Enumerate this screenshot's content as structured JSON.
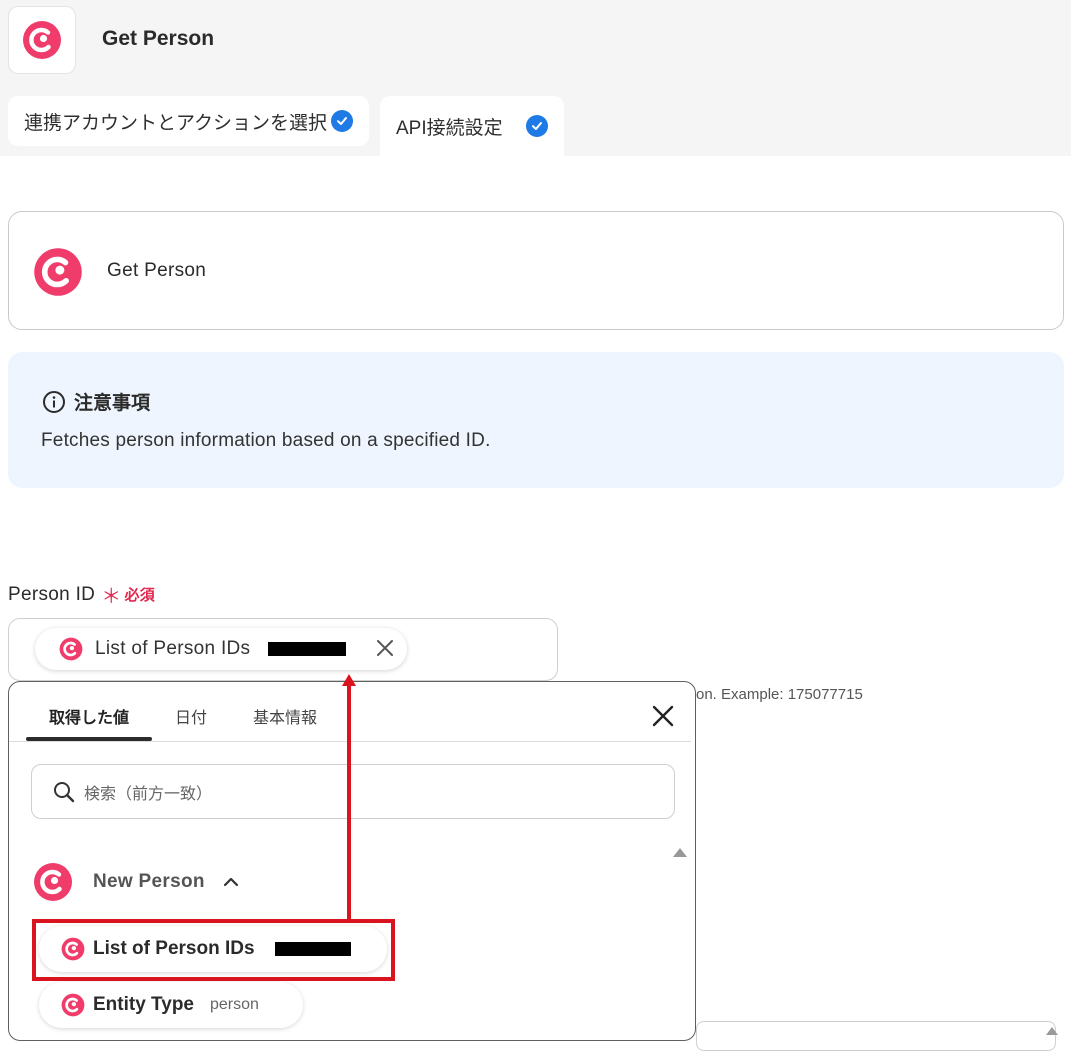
{
  "header": {
    "title": "Get Person"
  },
  "tabs": [
    {
      "label": "連携アカウントとアクションを選択",
      "checked": true
    },
    {
      "label": "API接続設定",
      "checked": true
    }
  ],
  "action_card": {
    "title": "Get Person"
  },
  "notice": {
    "heading": "注意事項",
    "body": "Fetches person information based on a specified ID."
  },
  "field": {
    "label": "Person ID",
    "required_mark": "＊",
    "required_text": "必須",
    "chip_label": "List of Person IDs",
    "helper_text": "on. Example: 175077715"
  },
  "dropdown": {
    "tabs": [
      "取得した値",
      "日付",
      "基本情報"
    ],
    "active_tab": "取得した値",
    "search_placeholder": "検索（前方一致）",
    "group_label": "New Person",
    "items": [
      {
        "label": "List of Person IDs",
        "value": ""
      },
      {
        "label": "Entity Type",
        "value": "person"
      }
    ]
  },
  "colors": {
    "brand": "#f03c6a",
    "accent": "#1e7be6",
    "highlight": "#d9141e",
    "notice_bg": "#eef5fe"
  },
  "icons": [
    "app-logo-icon",
    "check-icon",
    "info-icon",
    "close-icon",
    "search-icon",
    "chevron-up-icon"
  ]
}
